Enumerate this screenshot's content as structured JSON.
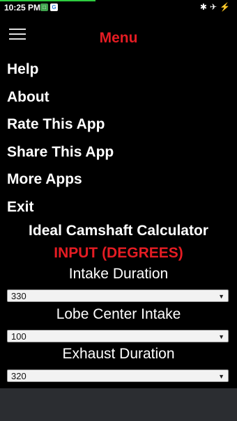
{
  "status_bar": {
    "time": "10:25 PM",
    "icons": [
      "notification-green-icon",
      "notification-g-icon",
      "bluetooth-icon",
      "airplane-icon",
      "charging-icon"
    ],
    "accent": "#2ecc40"
  },
  "header": {
    "title": "Menu",
    "title_color": "#e51c23"
  },
  "menu": {
    "items": [
      {
        "label": "Help"
      },
      {
        "label": "About"
      },
      {
        "label": "Rate This App"
      },
      {
        "label": "Share This App"
      },
      {
        "label": "More Apps"
      },
      {
        "label": "Exit"
      }
    ]
  },
  "main": {
    "app_title": "Ideal Camshaft Calculator",
    "input_heading": "INPUT (DEGREES)",
    "fields": [
      {
        "label": "Intake Duration",
        "value": "330"
      },
      {
        "label": "Lobe Center Intake",
        "value": "100"
      },
      {
        "label": "Exhaust Duration",
        "value": "320"
      }
    ]
  }
}
